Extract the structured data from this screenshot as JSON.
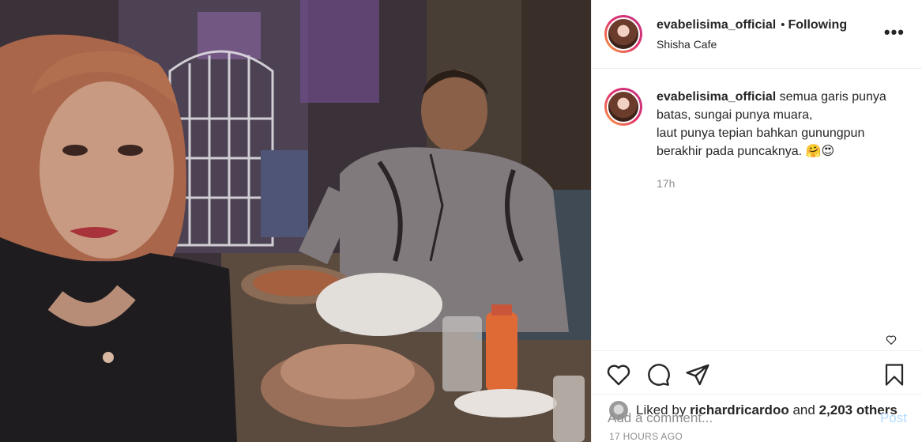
{
  "header": {
    "username": "evabelisima_official",
    "separator": "•",
    "follow_status": "Following",
    "location": "Shisha Cafe",
    "more_label": "•••"
  },
  "caption": {
    "username": "evabelisima_official",
    "line1": "semua garis punya",
    "line2": "batas, sungai punya muara,",
    "line3": "laut punya tepian bahkan gunungpun",
    "line4": "berakhir pada puncaknya.",
    "emojis": "🤗😍",
    "time": "17h"
  },
  "actions": {
    "like_icon": "heart-icon",
    "comment_icon": "comment-icon",
    "share_icon": "share-icon",
    "save_icon": "bookmark-icon"
  },
  "likes": {
    "prefix": "Liked by",
    "user": "richardricardoo",
    "and": "and",
    "others": "2,203 others"
  },
  "posted_ago": "17 HOURS AGO",
  "comment_box": {
    "placeholder": "Add a comment...",
    "post_label": "Post"
  },
  "colors": {
    "story_ring_start": "#f9a63a",
    "story_ring_end": "#c13584",
    "post_button_disabled": "#b3dbff",
    "secondary_text": "#8e8e8e"
  }
}
